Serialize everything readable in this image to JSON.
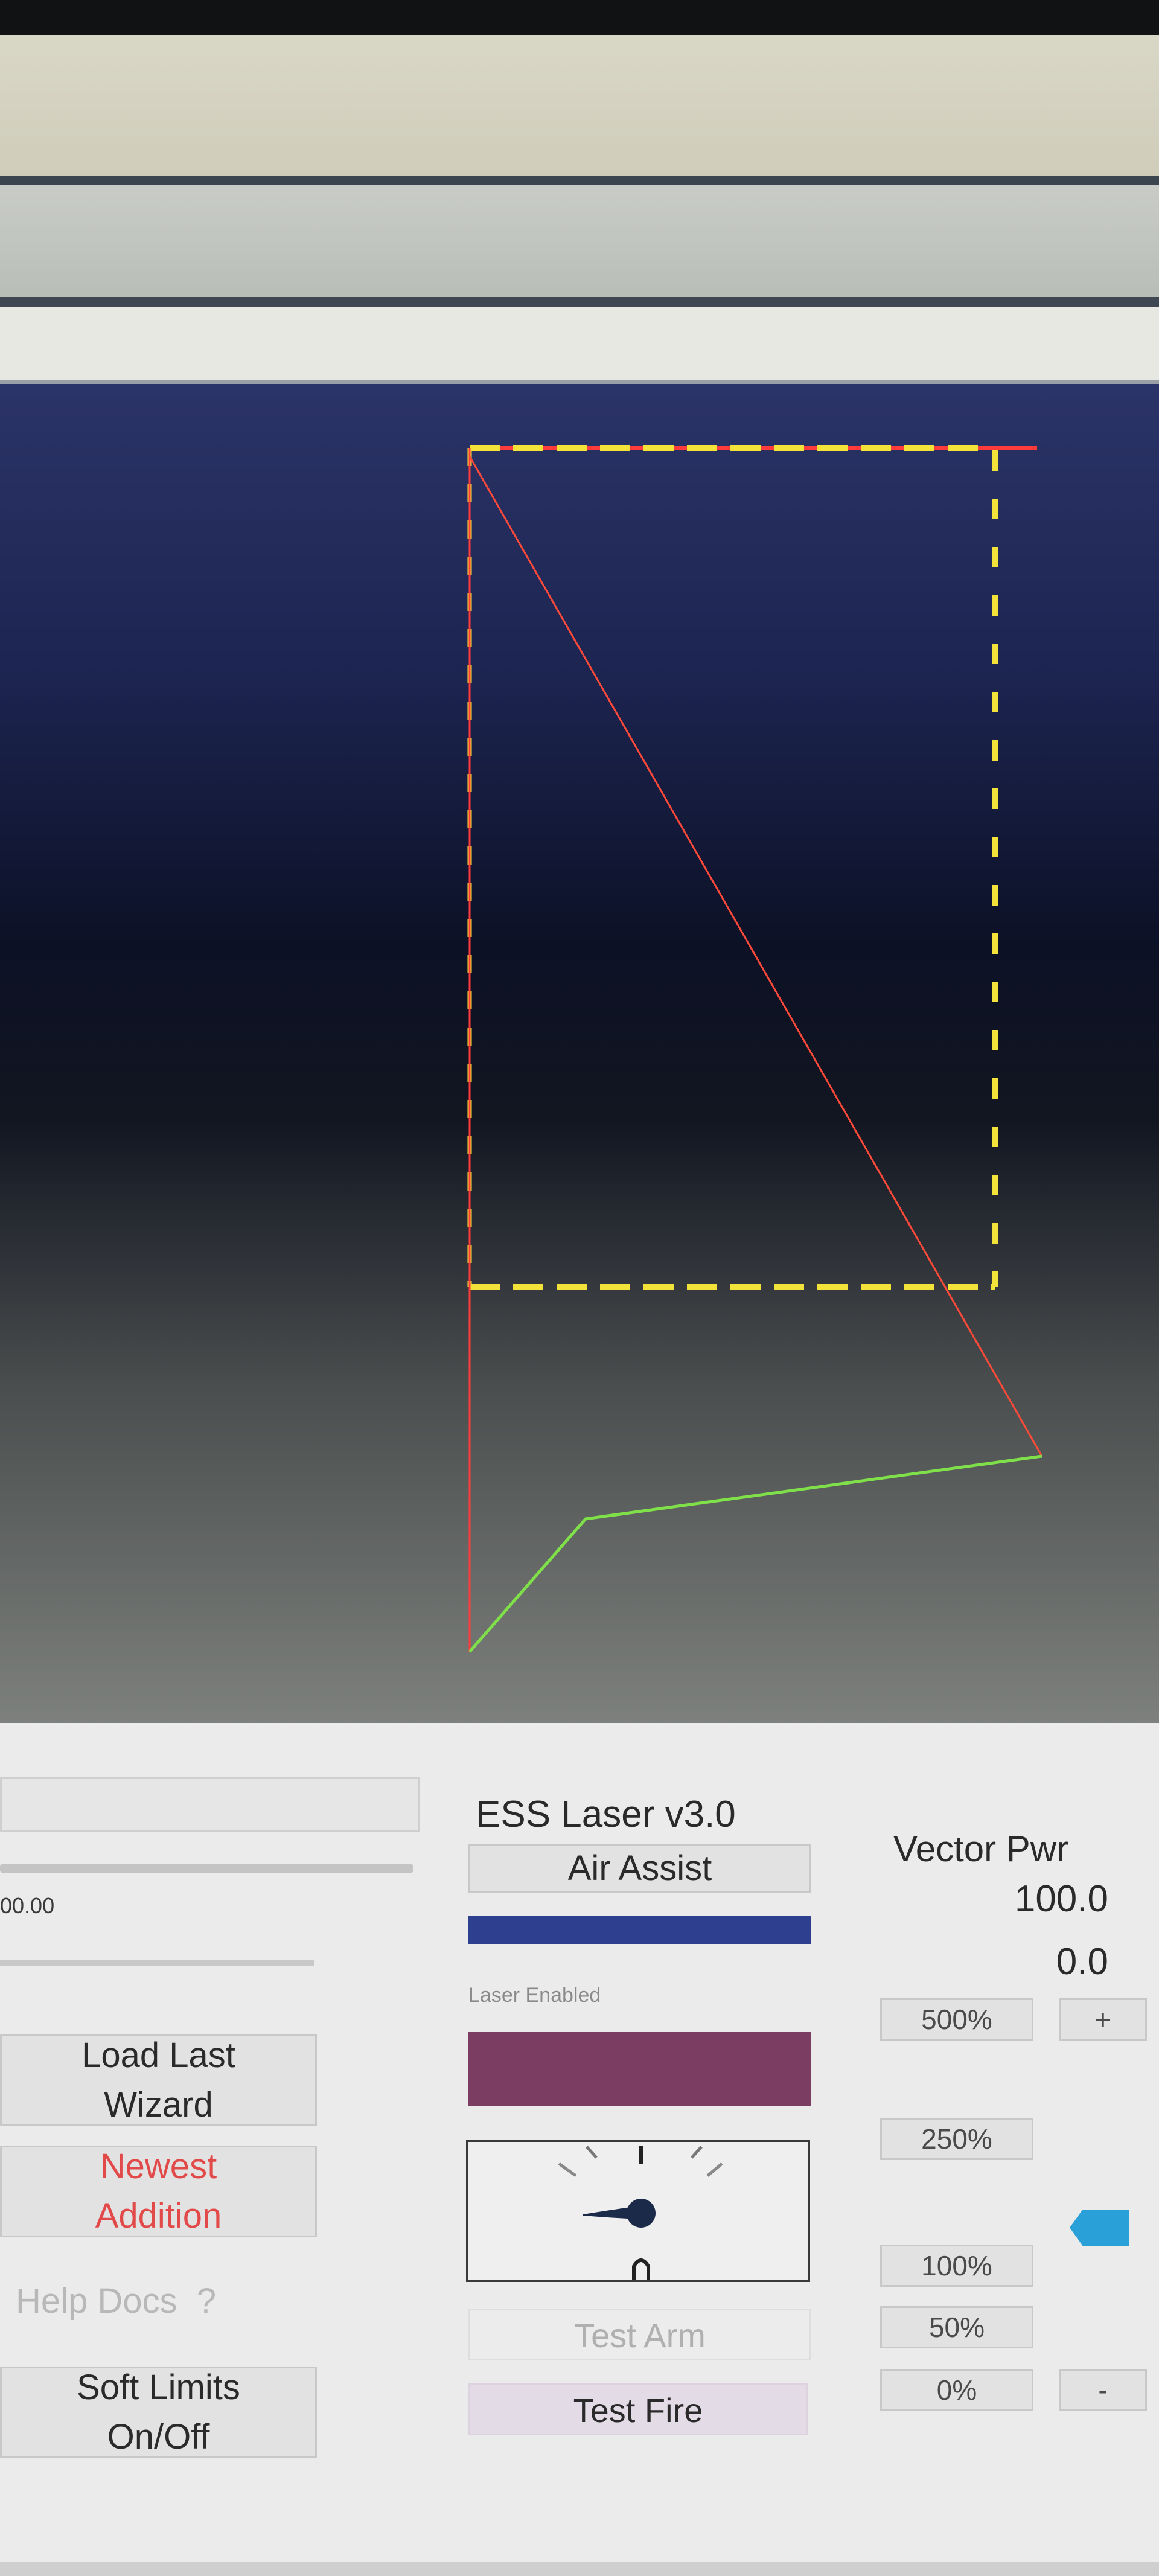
{
  "panel": {
    "left": {
      "coord_readout": "00.00",
      "load_last_wizard_label": "Load Last\nWizard",
      "newest_addition_label": "Newest\nAddition",
      "help_docs_label": "Help Docs  ?",
      "soft_limits_label": "Soft Limits\nOn/Off"
    },
    "laser": {
      "title": "ESS Laser v3.0",
      "air_assist_label": "Air Assist",
      "air_assist_color": "#2f3f8f",
      "laser_enabled_label": "Laser Enabled",
      "laser_enabled_color": "#7c3d63",
      "test_arm_label": "Test Arm",
      "test_fire_label": "Test Fire"
    },
    "power": {
      "title": "Vector Pwr",
      "value": "100.0",
      "secondary_value": "0.0",
      "preset_500": "500%",
      "preset_250": "250%",
      "preset_100": "100%",
      "preset_50": "50%",
      "preset_0": "0%",
      "plus_label": "+",
      "minus_label": "-",
      "indicator_color": "#2aa0d8"
    }
  },
  "viewport": {
    "colors": {
      "boundary": "#f2e23a",
      "rapid": "#ff3b3b",
      "feed": "#7fe04a"
    }
  }
}
